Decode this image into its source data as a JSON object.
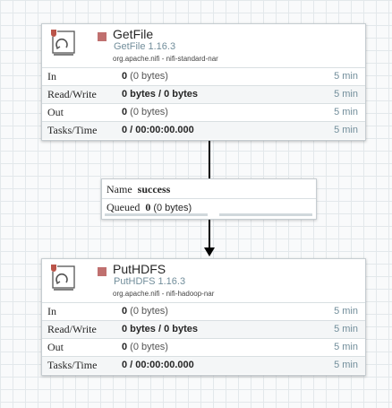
{
  "processors": [
    {
      "name": "GetFile",
      "type": "GetFile 1.16.3",
      "bundle": "org.apache.nifi - nifi-standard-nar",
      "stats": [
        {
          "label": "In",
          "value_bold": "0",
          "value_rest": " (0 bytes)",
          "time": "5 min"
        },
        {
          "label": "Read/Write",
          "value_bold": "0 bytes / 0 bytes",
          "value_rest": "",
          "time": "5 min"
        },
        {
          "label": "Out",
          "value_bold": "0",
          "value_rest": " (0 bytes)",
          "time": "5 min"
        },
        {
          "label": "Tasks/Time",
          "value_bold": "0 / 00:00:00.000",
          "value_rest": "",
          "time": "5 min"
        }
      ]
    },
    {
      "name": "PutHDFS",
      "type": "PutHDFS 1.16.3",
      "bundle": "org.apache.nifi - nifi-hadoop-nar",
      "stats": [
        {
          "label": "In",
          "value_bold": "0",
          "value_rest": " (0 bytes)",
          "time": "5 min"
        },
        {
          "label": "Read/Write",
          "value_bold": "0 bytes / 0 bytes",
          "value_rest": "",
          "time": "5 min"
        },
        {
          "label": "Out",
          "value_bold": "0",
          "value_rest": " (0 bytes)",
          "time": "5 min"
        },
        {
          "label": "Tasks/Time",
          "value_bold": "0 / 00:00:00.000",
          "value_rest": "",
          "time": "5 min"
        }
      ]
    }
  ],
  "connection": {
    "name_label": "Name",
    "name_value": "success",
    "queued_label": "Queued",
    "queued_count": "0",
    "queued_size": "(0 bytes)"
  },
  "colors": {
    "stopped_status": "#c0706f",
    "type_text": "#728e9b",
    "icon_red": "#ba554a"
  },
  "icons": [
    "processor-icon",
    "stopped-status-icon"
  ]
}
